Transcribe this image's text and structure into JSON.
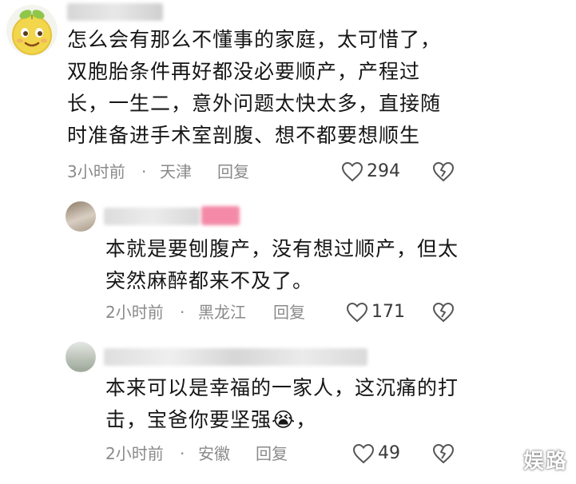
{
  "comments": [
    {
      "text_lines": [
        "怎么会有那么不懂事的家庭，太可惜了，",
        "双胞胎条件再好都没必要顺产，产程过",
        "长，一生二，意外问题太快太多，直接随",
        "时准备进手术室剖腹、想不都要想顺生"
      ],
      "time": "3小时前",
      "separator": "·",
      "location": "天津",
      "reply_label": "回复",
      "likes": "294"
    },
    {
      "text_lines": [
        "本就是要刨腹产，没有想过顺产，但太",
        "突然麻醉都来不及了。"
      ],
      "time": "2小时前",
      "separator": "·",
      "location": "黑龙江",
      "reply_label": "回复",
      "likes": "171"
    },
    {
      "text_lines": [
        "本来可以是幸福的一家人，这沉痛的打",
        "击，宝爸你要坚强😭，"
      ],
      "time": "2小时前",
      "separator": "·",
      "location": "安徽",
      "reply_label": "回复",
      "likes": "49"
    }
  ],
  "watermark": "娱路",
  "colors": {
    "meta": "#8a8a8a",
    "text": "#161616",
    "pink_badge": "#f48aa8"
  },
  "icons": {
    "like": "heart-outline-icon",
    "dislike": "broken-heart-icon"
  }
}
